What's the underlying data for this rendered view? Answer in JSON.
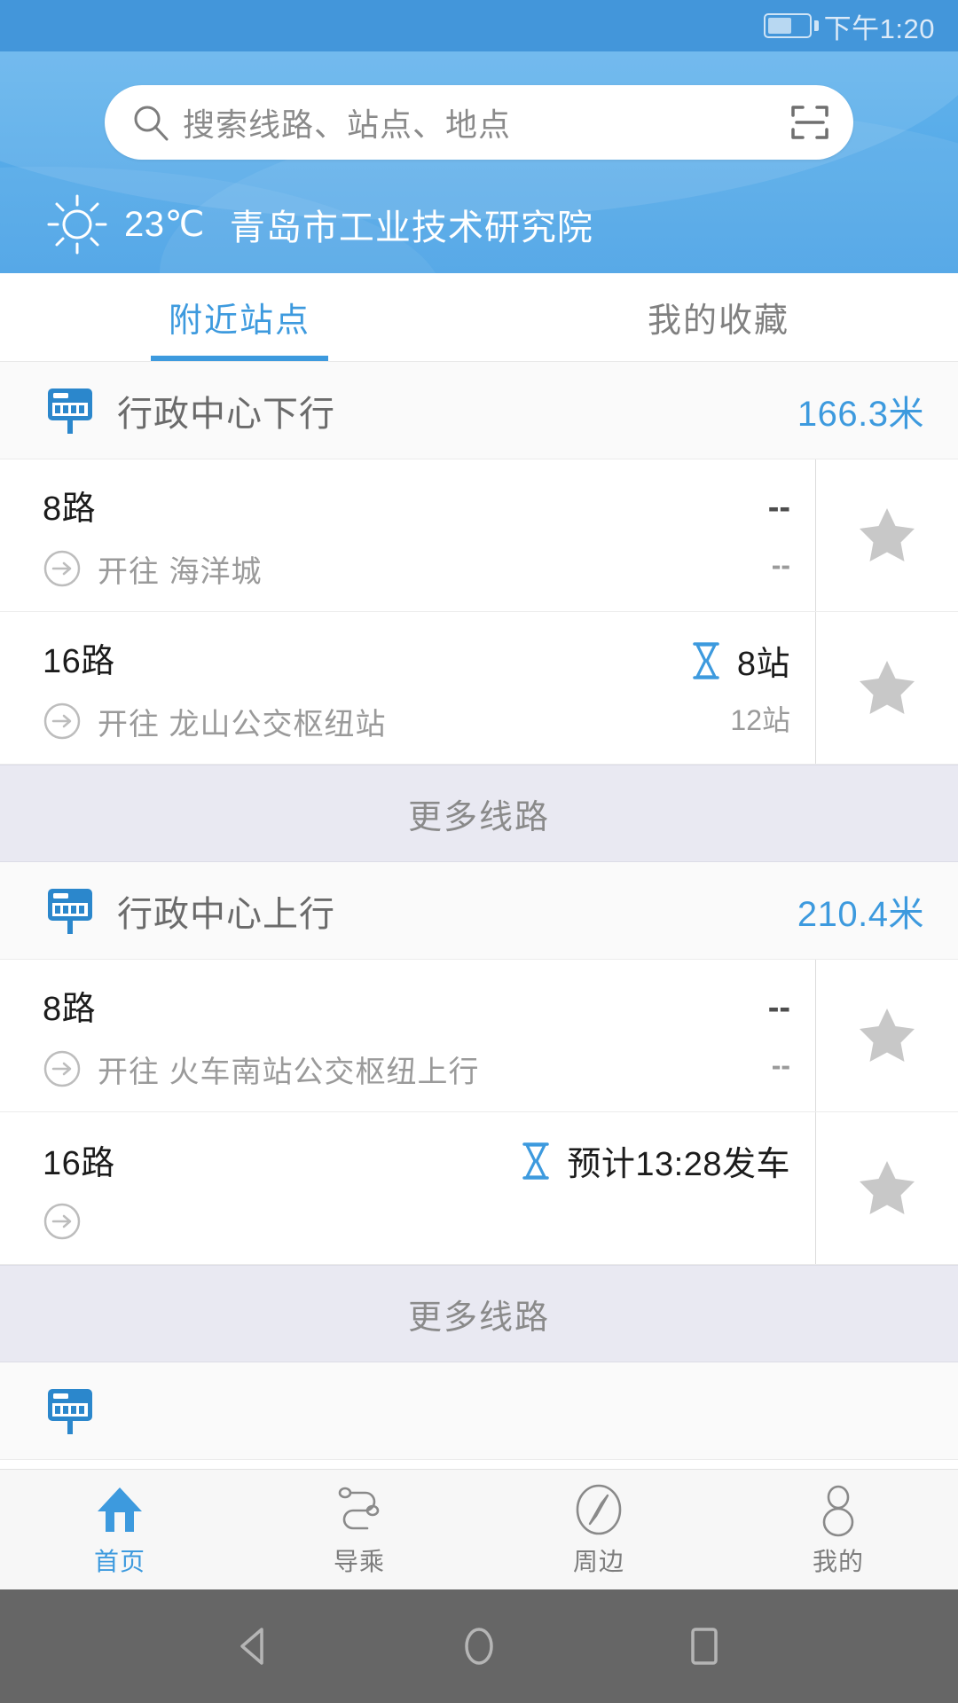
{
  "statusbar": {
    "time": "下午1:20",
    "battery_icon": "battery-icon"
  },
  "header": {
    "search": {
      "placeholder": "搜索线路、站点、地点",
      "search_icon": "search-icon",
      "scan_icon": "scan-icon"
    },
    "weather": {
      "icon": "sun-icon",
      "temperature": "23℃",
      "location": "青岛市工业技术研究院"
    }
  },
  "tabs": [
    {
      "label": "附近站点",
      "active": true
    },
    {
      "label": "我的收藏",
      "active": false
    }
  ],
  "more_label": "更多线路",
  "stations": [
    {
      "icon": "bus-stop-sign-icon",
      "name": "行政中心下行",
      "distance": "166.3米",
      "routes": [
        {
          "name": "8路",
          "dest_prefix": "开往",
          "destination": "开往 海洋城",
          "eta_icon": "",
          "eta_primary": "--",
          "eta_secondary": "--",
          "favorite_icon": "star-icon"
        },
        {
          "name": "16路",
          "dest_prefix": "开往",
          "destination": "开往 龙山公交枢纽站",
          "eta_icon": "hourglass-icon",
          "eta_primary": "8站",
          "eta_secondary": "12站",
          "favorite_icon": "star-icon"
        }
      ]
    },
    {
      "icon": "bus-stop-sign-icon",
      "name": "行政中心上行",
      "distance": "210.4米",
      "routes": [
        {
          "name": "8路",
          "dest_prefix": "开往",
          "destination": "开往 火车南站公交枢纽上行",
          "eta_icon": "",
          "eta_primary": "--",
          "eta_secondary": "--",
          "favorite_icon": "star-icon"
        },
        {
          "name": "16路",
          "dest_prefix": "",
          "destination": "",
          "eta_icon": "hourglass-icon",
          "eta_primary": "预计13:28发车",
          "eta_secondary": "",
          "favorite_icon": "star-icon"
        }
      ]
    }
  ],
  "bottom_nav": [
    {
      "label": "首页",
      "icon": "home-icon",
      "active": true
    },
    {
      "label": "导乘",
      "icon": "route-path-icon",
      "active": false
    },
    {
      "label": "周边",
      "icon": "compass-icon",
      "active": false
    },
    {
      "label": "我的",
      "icon": "person-icon",
      "active": false
    }
  ],
  "android_nav": [
    {
      "icon": "back-triangle-icon"
    },
    {
      "icon": "home-circle-icon"
    },
    {
      "icon": "recents-square-icon"
    }
  ],
  "colors": {
    "accent": "#3d9ade",
    "header_blue": "#58ace9",
    "statusbar_blue": "#4396da",
    "more_bg": "#e9e9f2",
    "star_gray": "#c8c8c8"
  }
}
